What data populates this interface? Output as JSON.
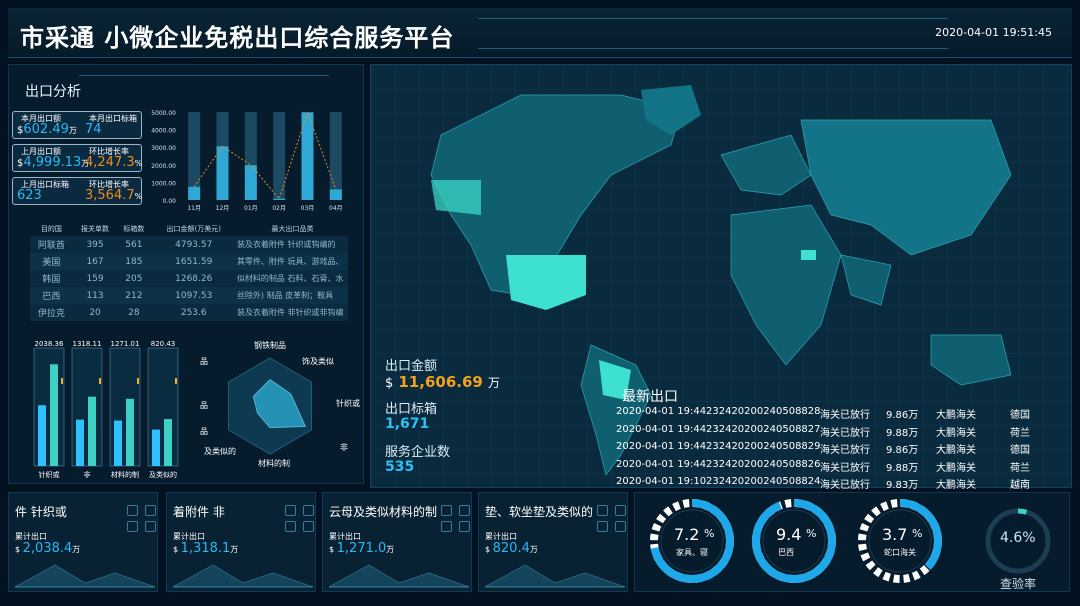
{
  "header": {
    "title": "市采通 小微企业免税出口综合服务平台",
    "datetime": "2020-04-01 19:51:45"
  },
  "analysis": {
    "title": "出口分析",
    "kpis": [
      {
        "label_a": "本月出口额",
        "value_a": "602.49",
        "unit_a": "万",
        "currency": "$",
        "label_b": "本月出口标箱",
        "value_b": "74",
        "unit_b": "",
        "orange_b": false
      },
      {
        "label_a": "上月出口额",
        "value_a": "4,999.13",
        "unit_a": "万",
        "currency": "$",
        "label_b": "环比增长率",
        "value_b": "4,247.3",
        "unit_b": "%",
        "orange_b": true
      },
      {
        "label_a": "上月出口标箱",
        "value_a": "623",
        "unit_a": "",
        "currency": "",
        "label_b": "环比增长率",
        "value_b": "3,564.7",
        "unit_b": "%",
        "orange_b": true
      }
    ]
  },
  "chart_data": [
    {
      "type": "bar",
      "categories": [
        "11月",
        "12月",
        "01月",
        "02月",
        "03月",
        "04月"
      ],
      "values": [
        750,
        3050,
        1980,
        70,
        4980,
        600
      ],
      "ylim": [
        0,
        5000
      ],
      "yticks": [
        "5000.00",
        "4000.00",
        "3000.00",
        "2000.00",
        "1000.00",
        "0.00"
      ],
      "colors": {
        "bar": "#2fa8d6",
        "line": "#e88a1f",
        "bg": "#1d4a63"
      }
    },
    {
      "type": "bar",
      "categories": [
        "针织或",
        "非",
        "材料的制",
        "及类似的"
      ],
      "series": [
        {
          "values": [
            2038.36,
            1318.11,
            1271.01,
            820.43
          ]
        }
      ],
      "value_labels": [
        "2038.36",
        "1318.11",
        "1271.01",
        "820.43"
      ]
    }
  ],
  "dest_table": {
    "headers": [
      "目的国",
      "报关单数",
      "标箱数",
      "出口金额(万美元)",
      "最大出口品类"
    ],
    "rows": [
      [
        "阿联酋",
        "395",
        "561",
        "4793.57",
        "装及衣着附件 针织或钩编的"
      ],
      [
        "美国",
        "167",
        "185",
        "1651.59",
        "其零件、附件 玩具、游戏品、"
      ],
      [
        "韩国",
        "159",
        "205",
        "1268.26",
        "似材料的制品 石料、石膏、水"
      ],
      [
        "巴西",
        "113",
        "212",
        "1097.53",
        "丝除外) 制品 皮革制；鞍具"
      ],
      [
        "伊拉克",
        "20",
        "28",
        "253.6",
        "装及衣着附件 非针织或非钩编"
      ]
    ]
  },
  "radar": {
    "labels": [
      "钢铁制品",
      "饰及类似",
      "针织或",
      "非",
      "材料的制",
      "及类似的",
      "品",
      "品",
      "品"
    ]
  },
  "stats": {
    "amount_label": "出口金额",
    "amount_value": "11,606.69",
    "amount_currency": "$",
    "amount_unit": "万",
    "boxes_label": "出口标箱",
    "boxes_value": "1,671",
    "companies_label": "服务企业数",
    "companies_value": "535"
  },
  "latest": {
    "title": "最新出口",
    "rows": [
      [
        "2020-04-01 19:44",
        "232420200240508828",
        "海关已放行",
        "9.86万",
        "大鹏海关",
        "德国"
      ],
      [
        "2020-04-01 19:44",
        "232420200240508827",
        "海关已放行",
        "9.88万",
        "大鹏海关",
        "荷兰"
      ],
      [
        "2020-04-01 19:44",
        "232420200240508829",
        "海关已放行",
        "9.86万",
        "大鹏海关",
        "德国"
      ],
      [
        "2020-04-01 19:44",
        "232420200240508826",
        "海关已放行",
        "9.88万",
        "大鹏海关",
        "荷兰"
      ],
      [
        "2020-04-01 19:10",
        "232420200240508824",
        "海关已放行",
        "9.83万",
        "大鹏海关",
        "越南"
      ]
    ]
  },
  "cards": [
    {
      "title": "件          针织或",
      "sub": "累计出口",
      "currency": "$",
      "value": "2,038.4",
      "unit": "万"
    },
    {
      "title": "着附件          非",
      "sub": "累计出口",
      "currency": "$",
      "value": "1,318.1",
      "unit": "万"
    },
    {
      "title": "云母及类似材料的制",
      "sub": "累计出口",
      "currency": "$",
      "value": "1,271.0",
      "unit": "万"
    },
    {
      "title": "垫、软坐垫及类似的",
      "sub": "累计出口",
      "currency": "$",
      "value": "820.4",
      "unit": "万"
    }
  ],
  "gauges": [
    {
      "value": "7.2",
      "pct": "%",
      "sub": "家具、寝",
      "level": 0.72
    },
    {
      "value": "9.4",
      "pct": "%",
      "sub": "巴西",
      "level": 0.94
    },
    {
      "value": "3.7",
      "pct": "%",
      "sub": "蛇口海关",
      "level": 0.37
    },
    {
      "value": "4.6%",
      "pct": "",
      "sub": "查验率",
      "level": 0.046
    }
  ],
  "colors": {
    "accent": "#2bb8f0",
    "orange": "#f08a1a",
    "teal": "#3fd0c6",
    "bg": "#031220"
  }
}
